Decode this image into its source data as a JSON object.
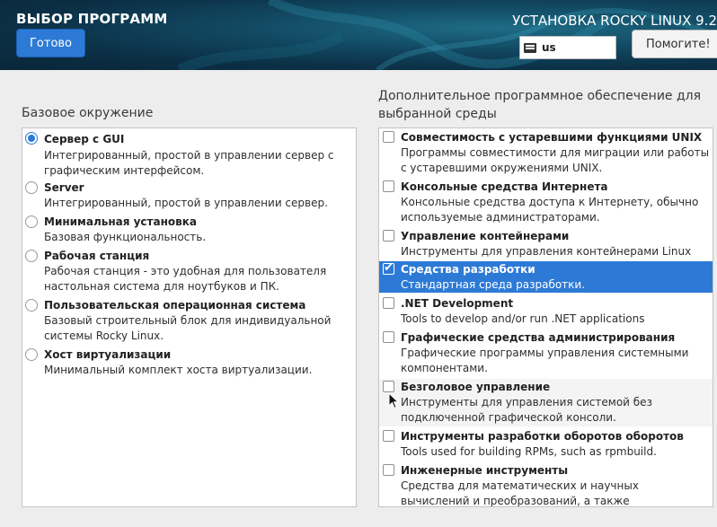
{
  "header": {
    "page_title": "ВЫБОР ПРОГРАММ",
    "done_label": "Готово",
    "product_title": "УСТАНОВКА ROCKY LINUX 9.2",
    "keyboard_layout": "us",
    "help_label": "Помогите!"
  },
  "base_env": {
    "title": "Базовое окружение",
    "items": [
      {
        "name": "Сервер с GUI",
        "desc": "Интегрированный, простой в управлении сервер с графическим интерфейсом.",
        "selected": true
      },
      {
        "name": "Server",
        "desc": "Интегрированный, простой в управлении сервер.",
        "selected": false
      },
      {
        "name": "Минимальная установка",
        "desc": "Базовая функциональность.",
        "selected": false
      },
      {
        "name": "Рабочая станция",
        "desc": "Рабочая станция - это удобная для пользователя настольная система для ноутбуков и ПК.",
        "selected": false
      },
      {
        "name": "Пользовательская операционная система",
        "desc": "Базовый строительный блок для индивидуальной системы Rocky Linux.",
        "selected": false
      },
      {
        "name": "Хост виртуализации",
        "desc": "Минимальный комплект хоста виртуализации.",
        "selected": false
      }
    ]
  },
  "addons": {
    "title": "Дополнительное программное обеспечение для выбранной среды",
    "items": [
      {
        "name": "Совместимость с устаревшими функциями UNIX",
        "desc": "Программы совместимости для миграции или работы с устаревшими окружениями UNIX.",
        "checked": false
      },
      {
        "name": "Консольные средства Интернета",
        "desc": "Консольные средства доступа к Интернету, обычно используемые администраторами.",
        "checked": false
      },
      {
        "name": "Управление контейнерами",
        "desc": "Инструменты для управления контейнерами Linux",
        "checked": false
      },
      {
        "name": "Средства разработки",
        "desc": "Стандартная среда разработки.",
        "checked": true
      },
      {
        "name": ".NET Development",
        "desc": "Tools to develop and/or run .NET applications",
        "checked": false
      },
      {
        "name": "Графические средства администрирования",
        "desc": "Графические программы управления системными компонентами.",
        "checked": false
      },
      {
        "name": "Безголовое управление",
        "desc": "Инструменты для управления системой без подключенной графической консоли.",
        "checked": false
      },
      {
        "name": "Инструменты разработки оборотов оборотов",
        "desc": "Tools used for building RPMs, such as rpmbuild.",
        "checked": false
      },
      {
        "name": "Инженерные инструменты",
        "desc": "Средства для математических и научных вычислений и преобразований, а также параллельных вычислений.",
        "checked": false
      }
    ]
  },
  "colors": {
    "accent": "#2d7ad6",
    "header_dark": "#0b2f45",
    "header_light": "#1f6c86"
  },
  "icons": {
    "keyboard": "keyboard-icon",
    "cursor": "mouse-pointer-icon"
  }
}
